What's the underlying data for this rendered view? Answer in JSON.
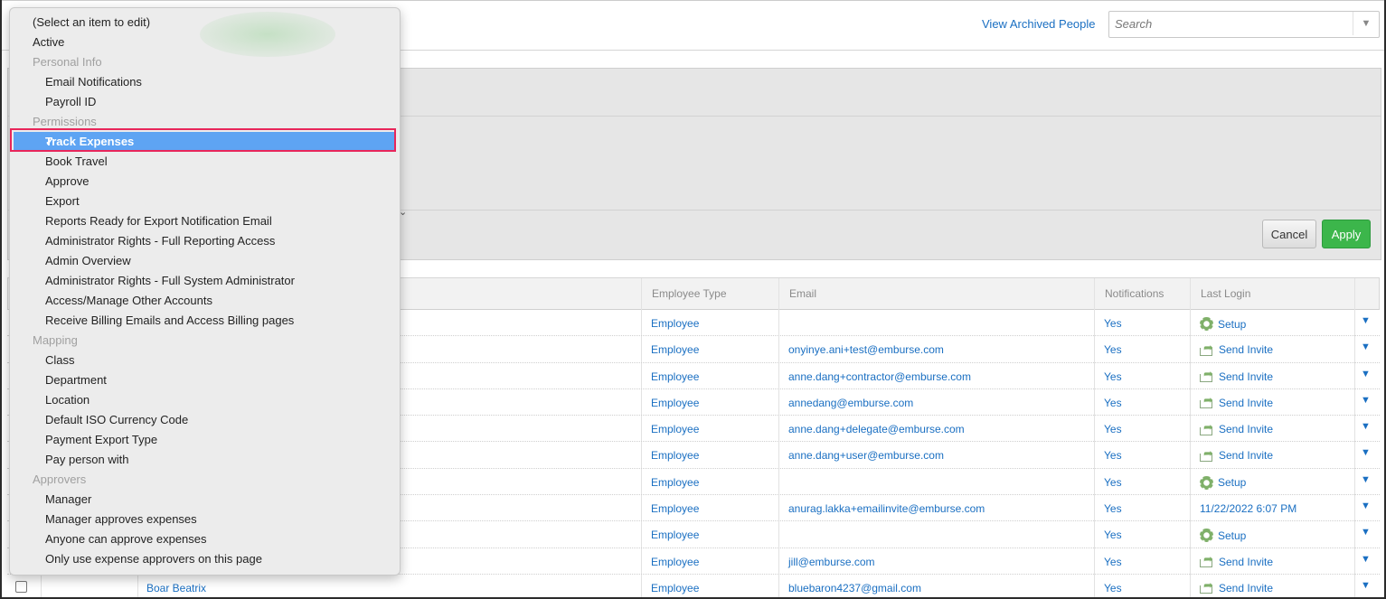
{
  "header": {
    "archived_link": "View Archived People",
    "search_placeholder": "Search"
  },
  "panel": {
    "cancel_label": "Cancel",
    "apply_label": "Apply"
  },
  "dropdown": {
    "items": [
      {
        "label": "(Select an item to edit)",
        "kind": "top"
      },
      {
        "label": "Active",
        "kind": "top"
      },
      {
        "label": "Personal Info",
        "kind": "group"
      },
      {
        "label": "Email Notifications",
        "kind": "item"
      },
      {
        "label": "Payroll ID",
        "kind": "item"
      },
      {
        "label": "Permissions",
        "kind": "group"
      },
      {
        "label": "Track Expenses",
        "kind": "selected"
      },
      {
        "label": "Book Travel",
        "kind": "item"
      },
      {
        "label": "Approve",
        "kind": "item"
      },
      {
        "label": "Export",
        "kind": "item"
      },
      {
        "label": "Reports Ready for Export Notification Email",
        "kind": "item"
      },
      {
        "label": "Administrator Rights - Full Reporting Access",
        "kind": "item"
      },
      {
        "label": "Admin Overview",
        "kind": "item"
      },
      {
        "label": "Administrator Rights - Full System Administrator",
        "kind": "item"
      },
      {
        "label": "Access/Manage Other Accounts",
        "kind": "item"
      },
      {
        "label": "Receive Billing Emails and Access Billing pages",
        "kind": "item"
      },
      {
        "label": "Mapping",
        "kind": "group"
      },
      {
        "label": "Class",
        "kind": "item"
      },
      {
        "label": "Department",
        "kind": "item"
      },
      {
        "label": "Location",
        "kind": "item"
      },
      {
        "label": "Default ISO Currency Code",
        "kind": "item"
      },
      {
        "label": "Payment Export Type",
        "kind": "item"
      },
      {
        "label": "Pay person with",
        "kind": "item"
      },
      {
        "label": "Approvers",
        "kind": "group"
      },
      {
        "label": "Manager",
        "kind": "item"
      },
      {
        "label": "Manager approves expenses",
        "kind": "item"
      },
      {
        "label": "Anyone can approve expenses",
        "kind": "item"
      },
      {
        "label": "Only use expense approvers on this page",
        "kind": "item"
      }
    ]
  },
  "table": {
    "columns": [
      "Employee Type",
      "Email",
      "Notifications",
      "Last Login"
    ],
    "rows": [
      {
        "name": "",
        "type": "Employee",
        "email": "",
        "notifications": "Yes",
        "login": "Setup",
        "login_icon": "gear-icon"
      },
      {
        "name": "",
        "type": "Employee",
        "email": "onyinye.ani+test@emburse.com",
        "notifications": "Yes",
        "login": "Send Invite",
        "login_icon": "send-invite-icon"
      },
      {
        "name": "",
        "type": "Employee",
        "email": "anne.dang+contractor@emburse.com",
        "notifications": "Yes",
        "login": "Send Invite",
        "login_icon": "send-invite-icon"
      },
      {
        "name": "",
        "type": "Employee",
        "email": "annedang@emburse.com",
        "notifications": "Yes",
        "login": "Send Invite",
        "login_icon": "send-invite-icon"
      },
      {
        "name": "",
        "type": "Employee",
        "email": "anne.dang+delegate@emburse.com",
        "notifications": "Yes",
        "login": "Send Invite",
        "login_icon": "send-invite-icon"
      },
      {
        "name": "",
        "type": "Employee",
        "email": "anne.dang+user@emburse.com",
        "notifications": "Yes",
        "login": "Send Invite",
        "login_icon": "send-invite-icon"
      },
      {
        "name": "",
        "type": "Employee",
        "email": "",
        "notifications": "Yes",
        "login": "Setup",
        "login_icon": "gear-icon"
      },
      {
        "name": "",
        "type": "Employee",
        "email": "anurag.lakka+emailinvite@emburse.com",
        "notifications": "Yes",
        "login": "11/22/2022 6:07 PM",
        "login_icon": ""
      },
      {
        "name": "",
        "type": "Employee",
        "email": "",
        "notifications": "Yes",
        "login": "Setup",
        "login_icon": "gear-icon"
      },
      {
        "name": "",
        "type": "Employee",
        "email": "jill@emburse.com",
        "notifications": "Yes",
        "login": "Send Invite",
        "login_icon": "send-invite-icon"
      },
      {
        "name": "Boar Beatrix",
        "type": "Employee",
        "email": "bluebaron4237@gmail.com",
        "notifications": "Yes",
        "login": "Send Invite",
        "login_icon": "send-invite-icon"
      }
    ]
  },
  "colors": {
    "link": "#1a6fc2",
    "selected": "#5ea4f3",
    "apply": "#3cb64b",
    "highlight": "#e8265a"
  }
}
